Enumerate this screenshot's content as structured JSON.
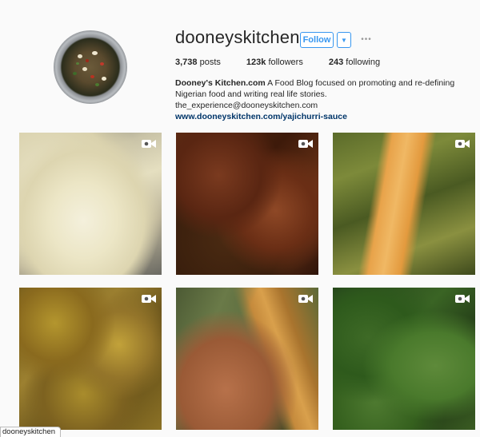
{
  "profile": {
    "username": "dooneyskitchen",
    "follow_label": "Follow",
    "dropdown_glyph": "▼",
    "more_glyph": "•••",
    "stats": {
      "posts_count": "3,738",
      "posts_label": "posts",
      "followers_count": "123k",
      "followers_label": "followers",
      "following_count": "243",
      "following_label": "following"
    },
    "bio": {
      "name": "Dooney's Kitchen.com",
      "text": "A Food Blog focused on promoting and re-defining Nigerian food and writing real life stories. the_experience@dooneyskitchen.com",
      "link": "www.dooneyskitchen.com/yajichurri-sauce"
    }
  },
  "posts": [
    {
      "icon": "video-camera-icon"
    },
    {
      "icon": "video-camera-icon"
    },
    {
      "icon": "video-camera-icon"
    },
    {
      "icon": "video-camera-icon"
    },
    {
      "icon": "video-camera-icon"
    },
    {
      "icon": "video-camera-icon"
    }
  ],
  "status_bar": {
    "text": "dooneyskitchen"
  },
  "colors": {
    "accent": "#3897f0",
    "link": "#003569",
    "background": "#fafafa"
  }
}
